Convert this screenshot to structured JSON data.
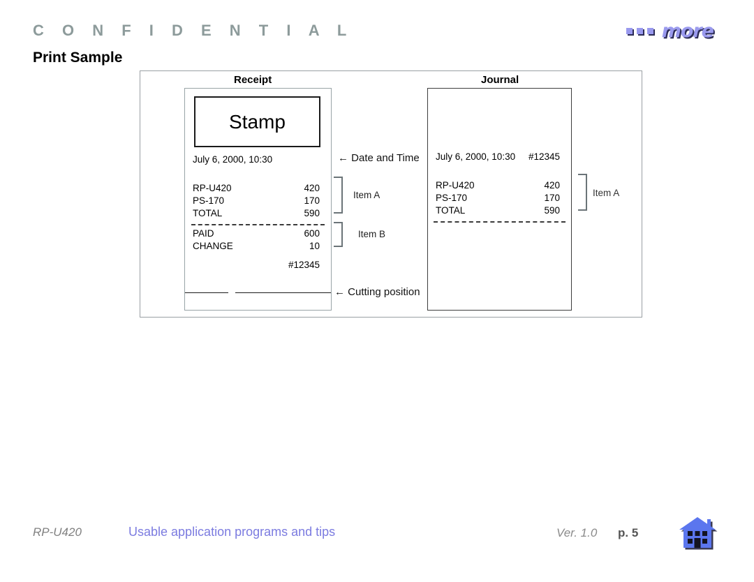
{
  "header": {
    "confidential": "C O N F I D E N T I A L",
    "title": "Print Sample"
  },
  "logo": {
    "word": "more",
    "square_count": 3,
    "color": "#9a9aee",
    "shadow_color": "#2b2b55"
  },
  "diagram": {
    "receipt": {
      "panel_title": "Receipt",
      "stamp_label": "Stamp",
      "datetime": "July 6, 2000, 10:30",
      "rows": [
        {
          "label": "RP-U420",
          "value": "420"
        },
        {
          "label": "PS-170",
          "value": "170"
        },
        {
          "label": "TOTAL",
          "value": "590"
        }
      ],
      "rows_b": [
        {
          "label": "PAID",
          "value": "600"
        },
        {
          "label": "CHANGE",
          "value": "10"
        }
      ],
      "receipt_no": "#12345"
    },
    "journal": {
      "panel_title": "Journal",
      "datetime": "July 6, 2000, 10:30",
      "journal_no": "#12345",
      "rows": [
        {
          "label": "RP-U420",
          "value": "420"
        },
        {
          "label": "PS-170",
          "value": "170"
        },
        {
          "label": "TOTAL",
          "value": "590"
        }
      ],
      "bracket_label": "Item A"
    },
    "annotations": {
      "date_and_time": "← Date and Time",
      "item_a": "Item A",
      "item_b": "Item B",
      "cutting_position": "← Cutting position"
    }
  },
  "footer": {
    "model": "RP-U420",
    "subtitle": "Usable application programs and tips",
    "version": "Ver. 1.0",
    "page": "p. 5",
    "home_icon": "home-icon",
    "link_color": "#7b7be0"
  }
}
